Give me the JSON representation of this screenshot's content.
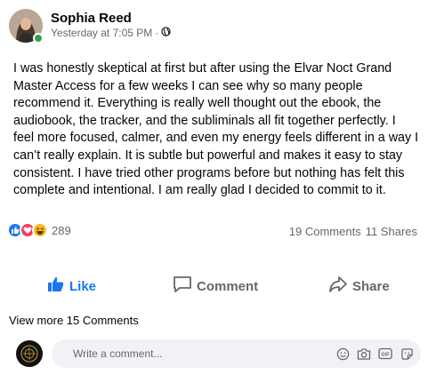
{
  "post": {
    "author": "Sophia Reed",
    "timestamp": "Yesterday at 7:05 PM",
    "separator": "·",
    "audience_icon": "globe-icon",
    "text": "I was honestly skeptical at first but after using the Elvar Noct Grand Master Access for a few weeks I can see why so many people recommend it. Everything is really well thought out the ebook, the audiobook, the tracker, and the subliminals all fit together perfectly. I feel more focused, calmer, and even my energy feels different in a way I can’t really explain. It is subtle but powerful and makes it easy to stay consistent. I have tried other programs before but nothing has felt this complete and intentional. I am really glad I decided to commit to it."
  },
  "reactions": {
    "icons": [
      "like-reaction-icon",
      "love-reaction-icon",
      "haha-reaction-icon"
    ],
    "count": "289",
    "comments": "19 Comments",
    "shares": "11 Shares"
  },
  "actions": {
    "like": "Like",
    "comment": "Comment",
    "share": "Share"
  },
  "comments": {
    "view_more": "View more 15 Comments",
    "placeholder": "Write a comment...",
    "icons": [
      "emoji-icon",
      "camera-icon",
      "gif-icon",
      "sticker-icon"
    ]
  },
  "colors": {
    "accent": "#1877f2",
    "online": "#31a24c",
    "muted": "#65676b",
    "input_bg": "#f0f2f5"
  }
}
